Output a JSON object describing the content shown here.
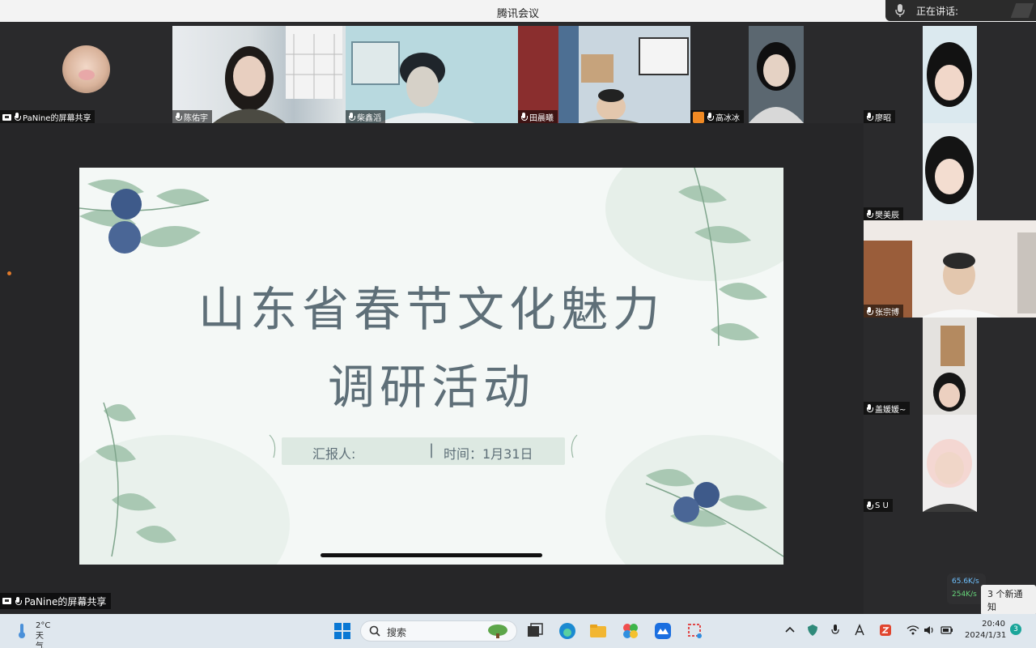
{
  "window": {
    "title": "腾讯会议"
  },
  "speaking": {
    "label": "正在讲话:"
  },
  "participants_top": [
    {
      "name": "PaNine的屏幕共享"
    },
    {
      "name": "陈佑宇"
    },
    {
      "name": "柴鑫滔"
    },
    {
      "name": "田晨曦"
    },
    {
      "name": "高冰冰"
    }
  ],
  "participants_right": [
    {
      "name": "廖昭"
    },
    {
      "name": "樊美辰"
    },
    {
      "name": "张宗博"
    },
    {
      "name": "盖媛媛~"
    },
    {
      "name": "S U"
    }
  ],
  "slide": {
    "title_line1": "山东省春节文化魅力",
    "title_line2": "调研活动",
    "reporter": "汇报人:",
    "separator": "|",
    "time": "时间：1月31日"
  },
  "share_label": "PaNine的屏幕共享",
  "network": {
    "up": "65.6K/s",
    "down": "254K/s"
  },
  "notification": "3 个新通知",
  "taskbar": {
    "temperature": "2°C",
    "weather": "天气冷",
    "search_label": "搜索",
    "time": "20:40",
    "date": "2024/1/31",
    "badge_count": "3"
  },
  "colors": {
    "accent": "#1aa59a",
    "slide_text": "#5e6f78",
    "blueberry": "#3e5a8a",
    "leaf": "#8fb89e"
  }
}
